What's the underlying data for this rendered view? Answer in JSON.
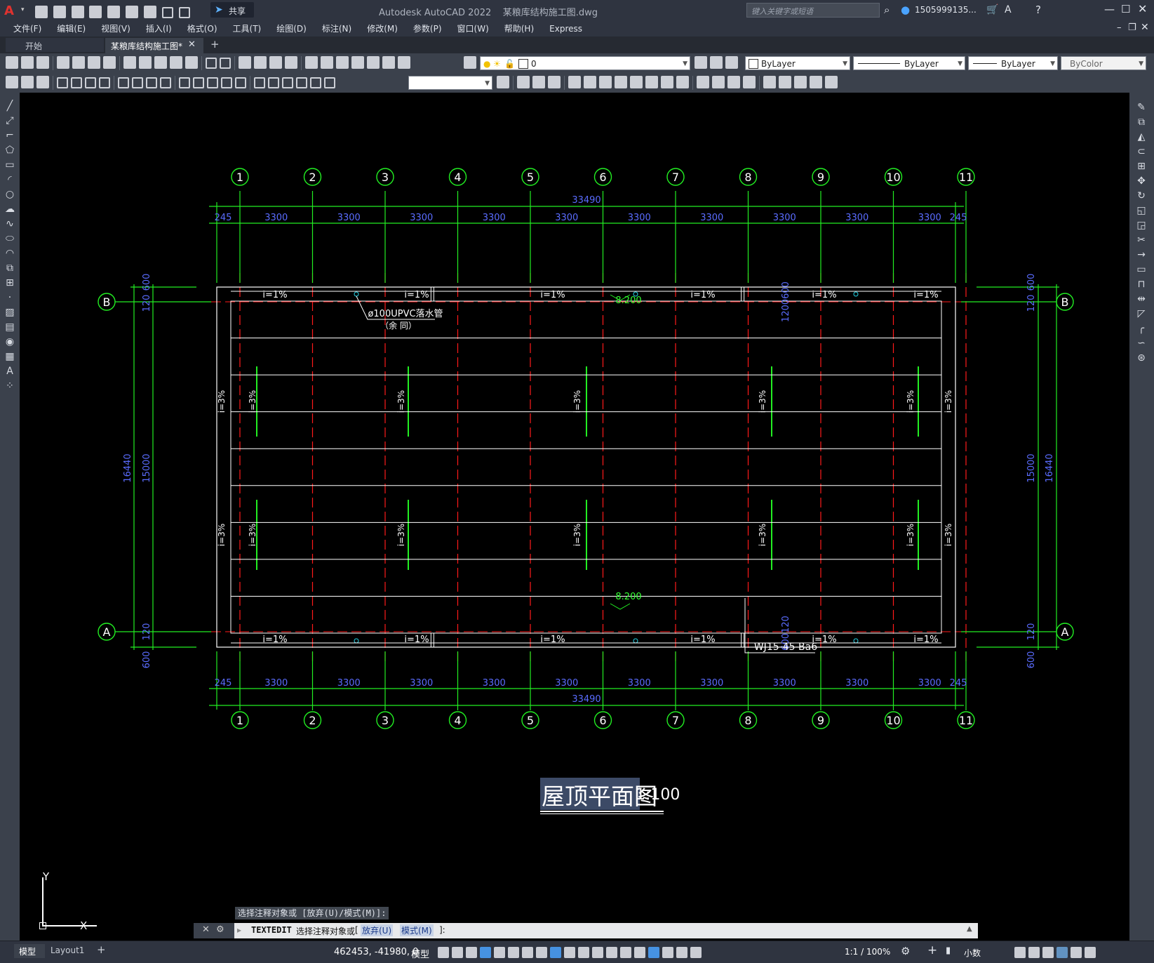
{
  "app": {
    "window_title": "Autodesk AutoCAD 2022    某粮库结构施工图.dwg",
    "search_placeholder": "键入关键字或短语",
    "user": "1505999135...",
    "share_label": "共享"
  },
  "menu": [
    "文件(F)",
    "编辑(E)",
    "视图(V)",
    "插入(I)",
    "格式(O)",
    "工具(T)",
    "绘图(D)",
    "标注(N)",
    "修改(M)",
    "参数(P)",
    "窗口(W)",
    "帮助(H)",
    "Express"
  ],
  "tabs": {
    "start": "开始",
    "active": "某粮库结构施工图*",
    "add": "+"
  },
  "properties": {
    "layer": "0",
    "color": "ByLayer",
    "linetype": "ByLayer",
    "lineweight": "ByLayer",
    "plotstyle": "ByColor"
  },
  "drawing": {
    "grid_cols": [
      "1",
      "2",
      "3",
      "4",
      "5",
      "6",
      "7",
      "8",
      "9",
      "10",
      "11"
    ],
    "grid_rows": [
      "A",
      "B"
    ],
    "total_width": "33490",
    "bay": "3300",
    "edge": "245",
    "total_height": "16440",
    "inner_height": "15000",
    "offset_600": "600",
    "offset_120": "120",
    "dim_1200600": "1200600",
    "dim_600120": "600120",
    "slope_1": "i=1%",
    "slope_3": "i=3%",
    "elev_top": "8.200",
    "elev_bottom": "8.200",
    "pipe_note": "ø100UPVC落水管",
    "pipe_note2": "（余   同）",
    "truss_label": "WJ15-45-Ba6",
    "title": "屋顶平面图",
    "scale": "1:100"
  },
  "ucs": {
    "x": "X",
    "y": "Y"
  },
  "command": {
    "history": "选择注释对象或 [放弃(U)/模式(M)]:",
    "prompt_cmd": "TEXTEDIT",
    "prompt_text": "选择注释对象或",
    "opt1": "放弃(U)",
    "opt2": "模式(M)",
    "prompt_tail": "]:"
  },
  "status": {
    "tab_model": "模型",
    "tab_layout": "Layout1",
    "coords": "462453, -41980, 0",
    "mode": "模型",
    "scale": "1:1 / 100%",
    "units": "小数"
  }
}
